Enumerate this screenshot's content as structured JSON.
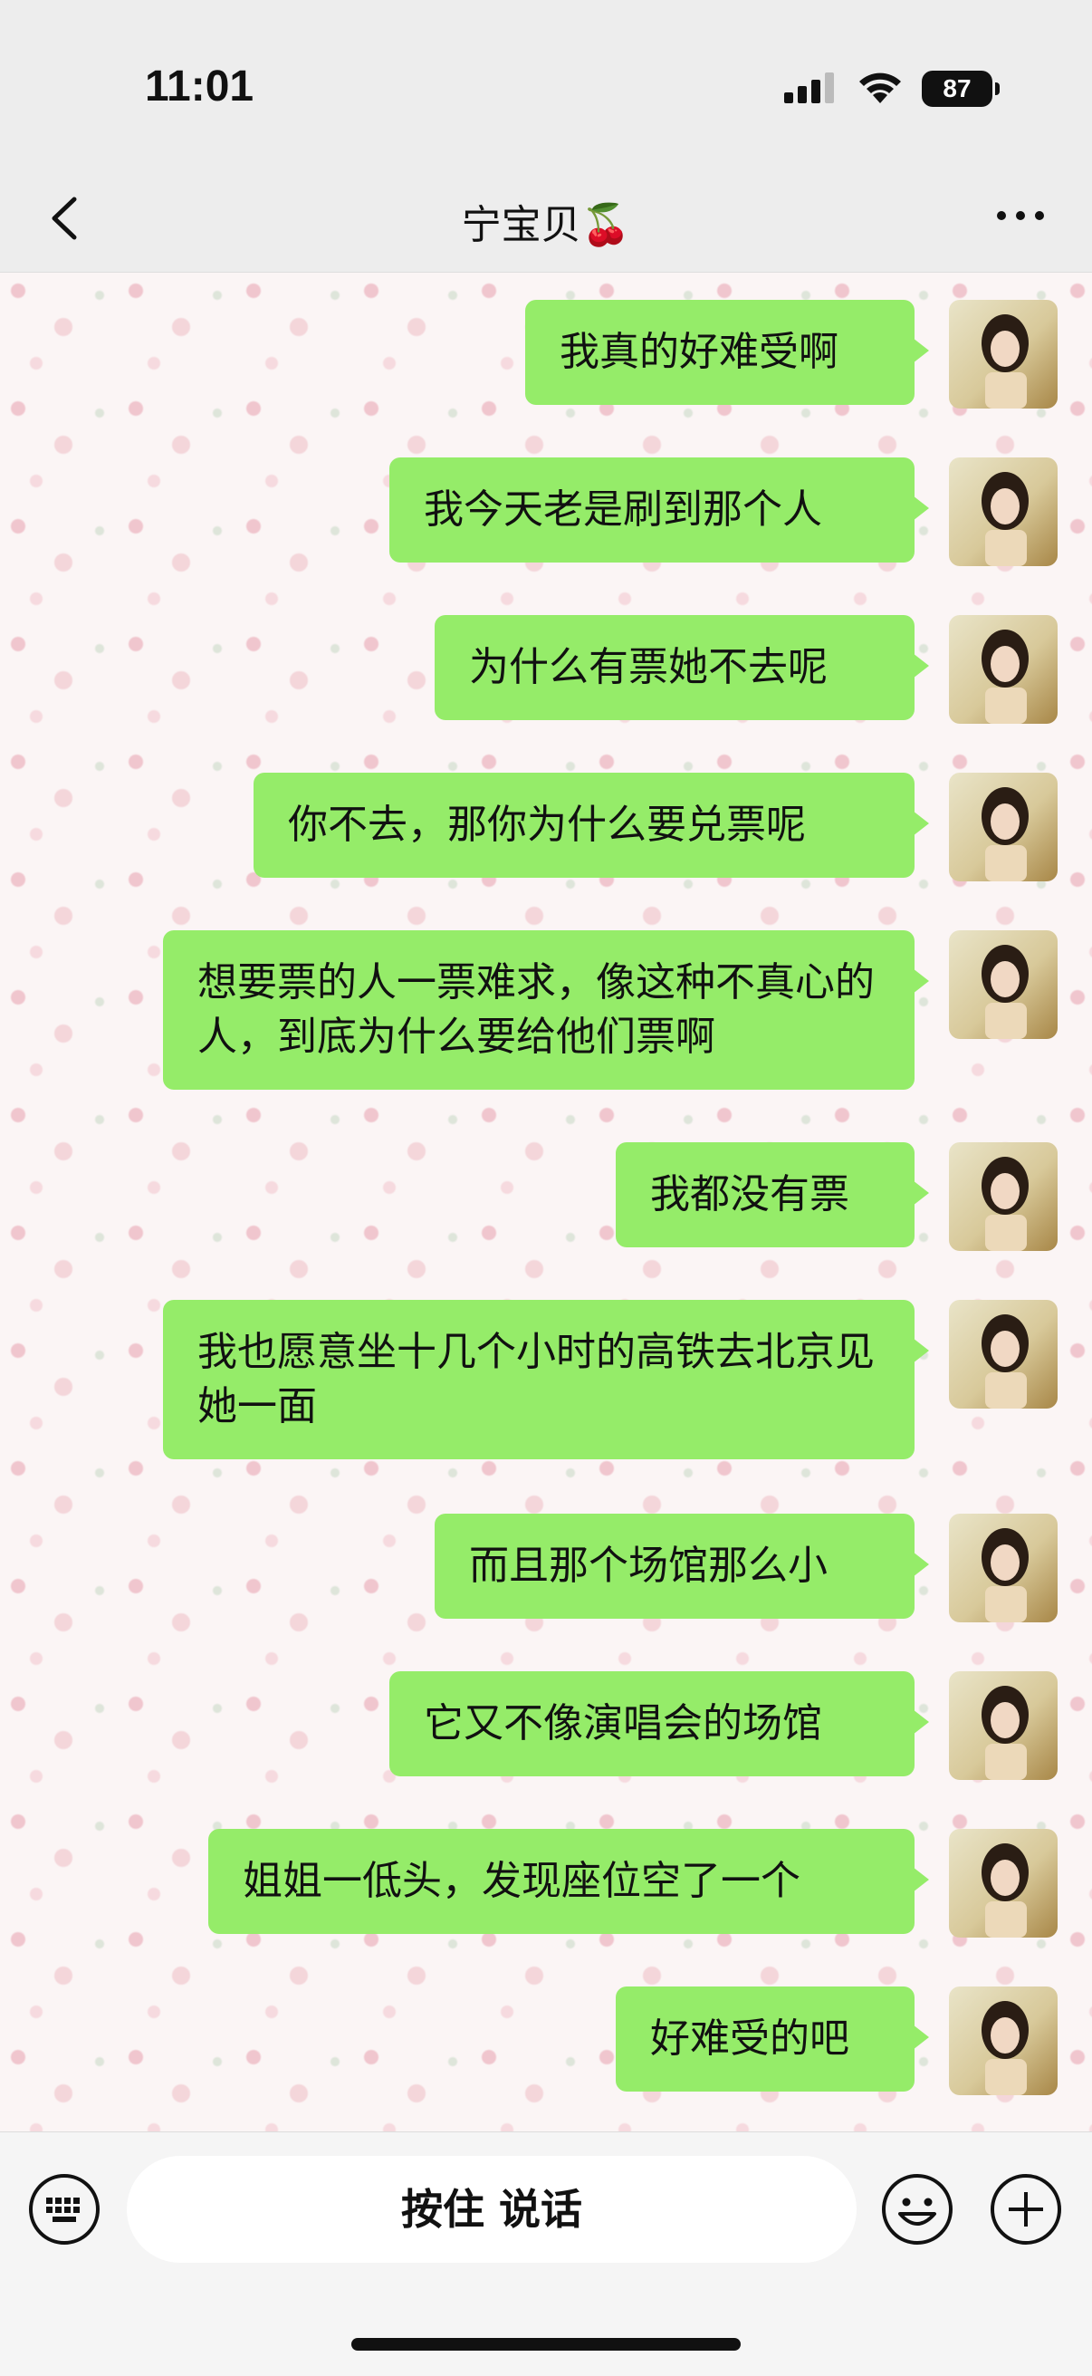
{
  "status_bar": {
    "time": "11:01",
    "battery": "87"
  },
  "header": {
    "title": "宁宝贝🍒"
  },
  "messages": [
    {
      "text": "我真的好难受啊"
    },
    {
      "text": "我今天老是刷到那个人"
    },
    {
      "text": "为什么有票她不去呢"
    },
    {
      "text": "你不去，那你为什么要兑票呢"
    },
    {
      "text": "想要票的人一票难求，像这种不真心的人，到底为什么要给他们票啊"
    },
    {
      "text": "我都没有票"
    },
    {
      "text": "我也愿意坐十几个小时的高铁去北京见她一面"
    },
    {
      "text": "而且那个场馆那么小"
    },
    {
      "text": "它又不像演唱会的场馆"
    },
    {
      "text": "姐姐一低头，发现座位空了一个"
    },
    {
      "text": "好难受的吧"
    }
  ],
  "input_bar": {
    "voice_label": "按住 说话"
  },
  "colors": {
    "bubble_self": "#95ec69",
    "bar_bg": "#ededed"
  }
}
